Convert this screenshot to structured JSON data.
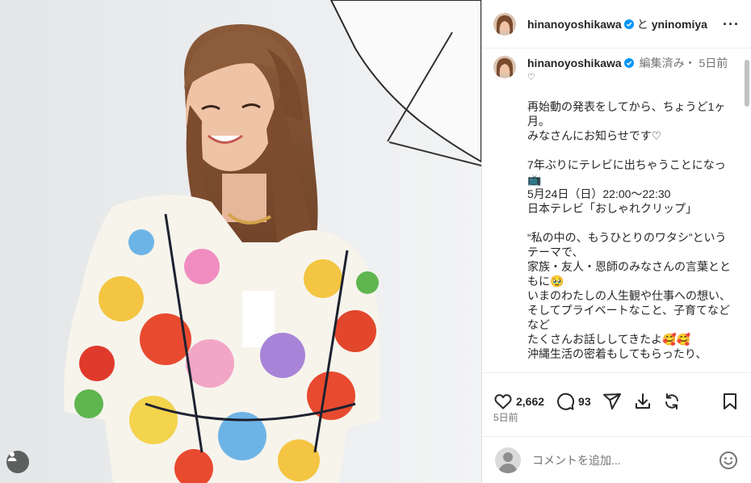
{
  "post": {
    "author": "hinanoyoshikawa",
    "collab_joiner": "と",
    "collaborator": "yninomiya",
    "edited": "編集済み・ 5日前",
    "heart": "♡",
    "caption": "再始動の発表をしてから、ちょうど1ヶ月。\nみなさんにお知らせです♡\n\n7年ぶりにテレビに出ちゃうことになっ📺\n5月24日（日）22:00〜22:30\n日本テレビ「おしゃれクリップ」\n\n“私の中の、もうひとりのワタシ”というテーマで、\n家族・友人・恩師のみなさんの言葉とともに🥹\nいまのわたしの人生観や仕事への想い、\nそしてプライベートなこと、子育てなどなど\nたくさんお話ししてきたよ🥰🥰\n沖縄生活の密着もしてもらったり、"
  },
  "actions": {
    "likes": "2,662",
    "comments": "93",
    "timestamp": "5日前"
  },
  "comment_box": {
    "placeholder": "コメントを追加..."
  },
  "colors": {
    "verified": "#0095f6",
    "muted": "#737373",
    "border": "#dbdbdb"
  },
  "icons": [
    "more-icon",
    "verified-icon",
    "heart-icon",
    "comment-icon",
    "share-icon",
    "download-icon",
    "repost-icon",
    "save-icon",
    "emoji-icon",
    "user-tag-icon"
  ]
}
